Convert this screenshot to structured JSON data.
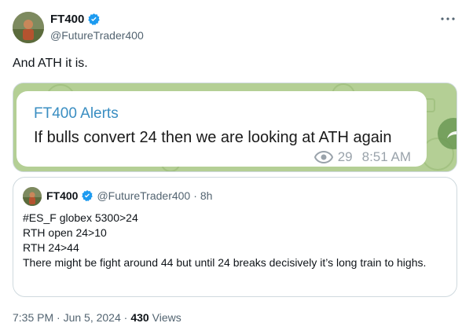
{
  "author": {
    "display_name": "FT400",
    "handle": "@FutureTrader400"
  },
  "tweet": {
    "text": "And ATH it is."
  },
  "media": {
    "card_title": "FT400 Alerts",
    "message": "If bulls convert 24 then we are looking at ATH again",
    "view_count": "29",
    "time": "8:51 AM"
  },
  "quote": {
    "display_name": "FT400",
    "handle": "@FutureTrader400",
    "separator": "·",
    "age": "8h",
    "lines": [
      "#ES_F  globex 5300>24",
      "RTH open 24>10",
      "RTH 24>44",
      "There might be fight around 44 but until 24 breaks decisively it’s long train to highs."
    ]
  },
  "footer": {
    "timestamp": "7:35 PM · Jun 5, 2024 ·",
    "views_count": "430",
    "views_label": "Views"
  },
  "colors": {
    "verified": "#1d9bf0",
    "link_blue": "#3a8ec2",
    "muted": "#536471",
    "media_green": "#b9d39b"
  },
  "icons": [
    "verified-badge-icon",
    "more-options-icon",
    "eye-icon",
    "share-icon"
  ]
}
